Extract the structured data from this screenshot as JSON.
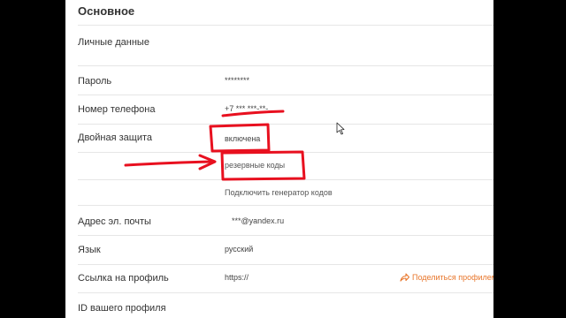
{
  "section": {
    "title": "Основное"
  },
  "rows": {
    "personal": {
      "label": "Личные данные"
    },
    "password": {
      "label": "Пароль",
      "value": "********"
    },
    "phone": {
      "label": "Номер телефона",
      "value": "+7 *** ***-**-"
    },
    "twofa": {
      "label": "Двойная защита",
      "value": "включена"
    },
    "backup": {
      "link": "резервные коды"
    },
    "generator": {
      "link": "Подключить генератор кодов"
    },
    "email": {
      "label": "Адрес эл. почты",
      "value": "***@yandex.ru"
    },
    "language": {
      "label": "Язык",
      "value": "русский"
    },
    "profile_link": {
      "label": "Ссылка на профиль",
      "value": "https://",
      "share_label": "Поделиться профилем"
    },
    "profile_id": {
      "label": "ID вашего профиля"
    }
  },
  "icons": {
    "share": "share-arrow-icon",
    "cursor": "mouse-pointer-icon"
  },
  "colors": {
    "annotation": "#e8101f",
    "accent": "#e8762b"
  }
}
